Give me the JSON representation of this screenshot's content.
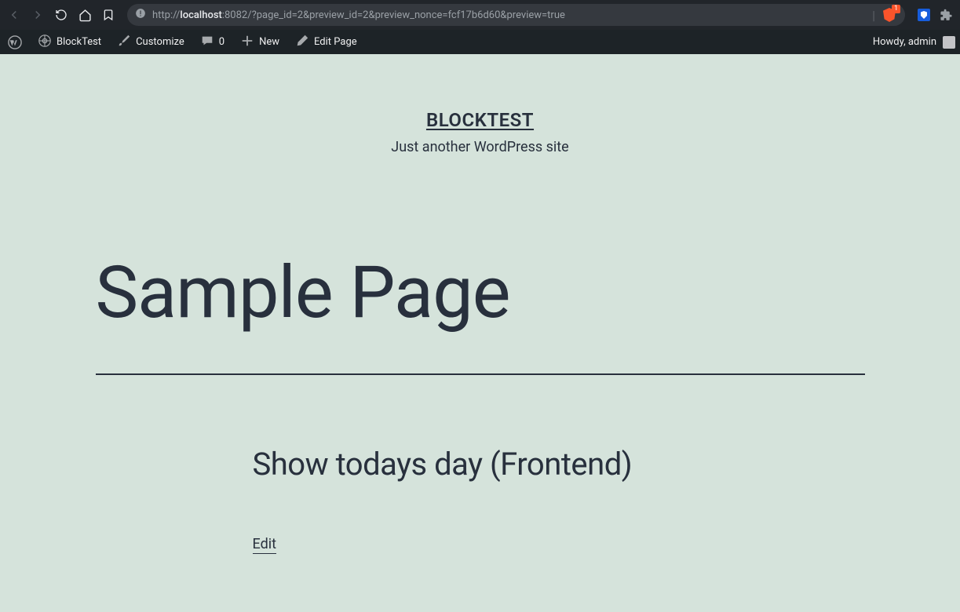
{
  "browser": {
    "url_protocol": "http://",
    "url_host": "localhost",
    "url_rest": ":8082/?page_id=2&preview_id=2&preview_nonce=fcf17b6d60&preview=true",
    "brave_badge": "1"
  },
  "adminbar": {
    "site_name": "BlockTest",
    "customize": "Customize",
    "comments_count": "0",
    "new": "New",
    "edit_page": "Edit Page",
    "howdy": "Howdy, admin"
  },
  "site": {
    "title": "BLOCKTEST",
    "tagline": "Just another WordPress site"
  },
  "page": {
    "title": "Sample Page",
    "block_heading": "Show todays day (Frontend)",
    "edit_label": "Edit"
  }
}
